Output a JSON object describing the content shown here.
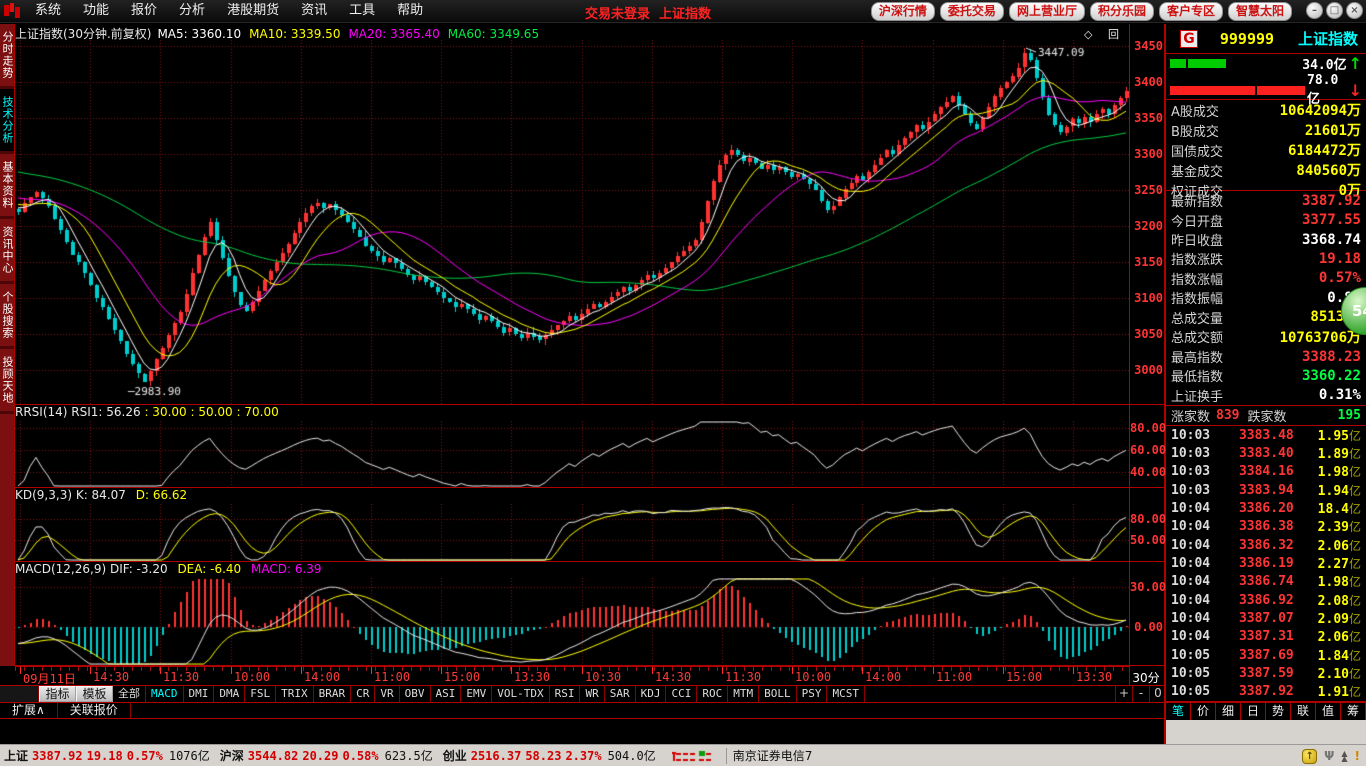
{
  "top": {
    "menu": [
      "系统",
      "功能",
      "报价",
      "分析",
      "港股期货",
      "资讯",
      "工具",
      "帮助"
    ],
    "login_status": "交易未登录",
    "current_quote": "上证指数",
    "buttons": [
      "沪深行情",
      "委托交易",
      "网上营业厅",
      "积分乐园",
      "客户专区",
      "智慧太阳"
    ],
    "window_controls": [
      "–",
      "□",
      "×"
    ]
  },
  "sidebar": {
    "items": [
      {
        "label": "分时走势",
        "active": false
      },
      {
        "label": "技术分析",
        "active": true
      },
      {
        "label": "基本资料",
        "active": false
      },
      {
        "label": "资讯中心",
        "active": false
      },
      {
        "label": "个股搜索",
        "active": false
      },
      {
        "label": "投顾天地",
        "active": false
      }
    ]
  },
  "chart": {
    "title": "上证指数(30分钟.前复权)",
    "ma_labels": [
      {
        "text": "MA5: 3360.10",
        "color": "#ffffff"
      },
      {
        "text": "MA10: 3339.50",
        "color": "#ffff00"
      },
      {
        "text": "MA20: 3365.40",
        "color": "#ff00ff"
      },
      {
        "text": "MA60: 3349.65",
        "color": "#00ee44"
      }
    ],
    "corner_icons": "◇ 回",
    "period": "30分钟"
  },
  "panels": {
    "rsi": {
      "white": "RRSI(14) RSI1: 56.26",
      "yellow": ": 30.00 : 50.00 : 70.00",
      "levels": [
        {
          "v": 80,
          "t": "80.00"
        },
        {
          "v": 60,
          "t": "60.00"
        },
        {
          "v": 40,
          "t": "40.00"
        }
      ]
    },
    "kd": {
      "white": "KD(9,3,3) K: 84.07",
      "yellow": "D: 66.62",
      "levels": [
        {
          "v": 80,
          "t": "80.00"
        },
        {
          "v": 50,
          "t": "50.00"
        }
      ]
    },
    "macd": {
      "white": "MACD(12,26,9) DIF: -3.20",
      "yellow": "DEA: -6.40",
      "magenta": "MACD: 6.39",
      "levels": [
        {
          "v": 30,
          "t": "30.00"
        },
        {
          "v": 0,
          "t": "0.00"
        }
      ]
    }
  },
  "indicator_bar": {
    "buttons": [
      "指标",
      "模板"
    ],
    "tabs": [
      "全部",
      "MACD",
      "DMI",
      "DMA",
      "FSL",
      "TRIX",
      "BRAR",
      "CR",
      "VR",
      "OBV",
      "ASI",
      "EMV",
      "VOL-TDX",
      "RSI",
      "WR",
      "SAR",
      "KDJ",
      "CCI",
      "ROC",
      "MTM",
      "BOLL",
      "PSY",
      "MCST"
    ],
    "active_tab": "MACD",
    "zoom": [
      "+",
      "-",
      "0"
    ]
  },
  "bottom_tabs": [
    "扩展∧",
    "关联报价"
  ],
  "status_bar": {
    "indices": [
      {
        "name": "上证",
        "value": "3387.92",
        "chg": "19.18",
        "pct": "0.57%",
        "amt": "1076亿"
      },
      {
        "name": "沪深",
        "value": "3544.82",
        "chg": "20.29",
        "pct": "0.58%",
        "amt": "623.5亿"
      },
      {
        "name": "创业",
        "value": "2516.37",
        "chg": "58.23",
        "pct": "2.37%",
        "amt": "504.0亿"
      }
    ],
    "broker": "南京证券电信7",
    "icons": [
      "coin-up-icon",
      "antenna-icon",
      "arrows-icon",
      "alert-icon"
    ]
  },
  "quote": {
    "logo": "G",
    "code": "999999",
    "name": "上证指数",
    "flow": {
      "up": "34.0亿",
      "up_arrow": "↑",
      "down": "78.0亿",
      "down_arrow": "↓",
      "up_segments": [
        16,
        38
      ],
      "down_segments": [
        85,
        48
      ]
    },
    "stats1": [
      {
        "label": "A股成交",
        "value": "10642094万"
      },
      {
        "label": "B股成交",
        "value": "21601万"
      },
      {
        "label": "国债成交",
        "value": "6184472万"
      },
      {
        "label": "基金成交",
        "value": "840560万"
      },
      {
        "label": "权证成交",
        "value": "0万"
      }
    ],
    "stats2": [
      {
        "label": "最新指数",
        "value": "3387.92",
        "color": "red"
      },
      {
        "label": "今日开盘",
        "value": "3377.55",
        "color": "red"
      },
      {
        "label": "昨日收盘",
        "value": "3368.74",
        "color": "white"
      },
      {
        "label": "指数涨跌",
        "value": "19.18",
        "color": "red"
      },
      {
        "label": "指数涨幅",
        "value": "0.57%",
        "color": "red"
      },
      {
        "label": "指数振幅",
        "value": "0.83",
        "color": "white"
      },
      {
        "label": "总成交量",
        "value": "851330",
        "color": "yellow"
      },
      {
        "label": "总成交额",
        "value": "10763706万",
        "color": "yellow"
      },
      {
        "label": "最高指数",
        "value": "3388.23",
        "color": "red"
      },
      {
        "label": "最低指数",
        "value": "3360.22",
        "color": "green"
      },
      {
        "label": "上证换手",
        "value": "0.31%",
        "color": "white"
      }
    ],
    "breadth": {
      "up_label": "涨家数",
      "up": "839",
      "down_label": "跌家数",
      "down": "195"
    },
    "ticks": [
      [
        "10:03",
        "3383.48",
        "1.95"
      ],
      [
        "10:03",
        "3383.40",
        "1.89"
      ],
      [
        "10:03",
        "3384.16",
        "1.98"
      ],
      [
        "10:03",
        "3383.94",
        "1.94"
      ],
      [
        "10:04",
        "3386.20",
        "18.4"
      ],
      [
        "10:04",
        "3386.38",
        "2.39"
      ],
      [
        "10:04",
        "3386.32",
        "2.06"
      ],
      [
        "10:04",
        "3386.19",
        "2.27"
      ],
      [
        "10:04",
        "3386.74",
        "1.98"
      ],
      [
        "10:04",
        "3386.92",
        "2.08"
      ],
      [
        "10:04",
        "3387.07",
        "2.09"
      ],
      [
        "10:04",
        "3387.31",
        "2.06"
      ],
      [
        "10:05",
        "3387.69",
        "1.84"
      ],
      [
        "10:05",
        "3387.59",
        "2.10"
      ],
      [
        "10:05",
        "3387.92",
        "1.91"
      ]
    ],
    "tick_suffix": "亿",
    "tabs": [
      "笔",
      "价",
      "细",
      "日",
      "势",
      "联",
      "值",
      "筹"
    ],
    "active_tab": "笔",
    "bubble": "54"
  },
  "chart_data": {
    "type": "candlestick",
    "symbol": "上证指数",
    "period": "30分钟",
    "ylim": [
      2953,
      3458
    ],
    "y_ticks": [
      3450,
      3400,
      3350,
      3300,
      3250,
      3200,
      3150,
      3100,
      3050,
      3000
    ],
    "x_labels": [
      "09月11日",
      "14:30",
      "11:30",
      "10:00",
      "14:00",
      "11:00",
      "15:00",
      "13:30",
      "10:30",
      "14:30",
      "11:30",
      "10:00",
      "14:00",
      "11:00",
      "15:00",
      "13:30"
    ],
    "high_annotation": 3447.09,
    "high_bar": 168,
    "low_annotation": 2983.9,
    "low_bar": 21,
    "closes": [
      3220,
      3232,
      3240,
      3247,
      3238,
      3228,
      3210,
      3195,
      3178,
      3160,
      3150,
      3135,
      3118,
      3100,
      3088,
      3072,
      3055,
      3040,
      3022,
      3008,
      2995,
      2984,
      2998,
      3015,
      3030,
      3048,
      3065,
      3080,
      3105,
      3135,
      3160,
      3185,
      3205,
      3180,
      3155,
      3130,
      3108,
      3090,
      3082,
      3095,
      3110,
      3125,
      3138,
      3150,
      3162,
      3175,
      3190,
      3205,
      3218,
      3228,
      3232,
      3225,
      3230,
      3222,
      3215,
      3205,
      3195,
      3185,
      3172,
      3165,
      3158,
      3150,
      3155,
      3148,
      3140,
      3132,
      3125,
      3130,
      3122,
      3115,
      3108,
      3100,
      3095,
      3088,
      3092,
      3085,
      3078,
      3070,
      3075,
      3068,
      3060,
      3052,
      3058,
      3050,
      3045,
      3052,
      3047,
      3042,
      3048,
      3055,
      3062,
      3068,
      3075,
      3070,
      3078,
      3085,
      3092,
      3088,
      3095,
      3102,
      3108,
      3115,
      3110,
      3118,
      3125,
      3132,
      3128,
      3135,
      3142,
      3150,
      3158,
      3165,
      3172,
      3180,
      3205,
      3235,
      3262,
      3285,
      3298,
      3305,
      3298,
      3290,
      3295,
      3288,
      3280,
      3285,
      3278,
      3282,
      3275,
      3268,
      3272,
      3265,
      3258,
      3250,
      3235,
      3222,
      3228,
      3240,
      3252,
      3260,
      3270,
      3265,
      3275,
      3285,
      3295,
      3305,
      3300,
      3312,
      3322,
      3330,
      3340,
      3335,
      3345,
      3355,
      3365,
      3372,
      3380,
      3368,
      3355,
      3342,
      3335,
      3350,
      3365,
      3380,
      3392,
      3400,
      3408,
      3420,
      3440,
      3430,
      3405,
      3378,
      3355,
      3340,
      3330,
      3338,
      3348,
      3342,
      3352,
      3345,
      3356,
      3362,
      3355,
      3368,
      3378,
      3387.92
    ],
    "indicators": {
      "ma": {
        "MA5": 3360.1,
        "MA10": 3339.5,
        "MA20": 3365.4,
        "MA60": 3349.65
      },
      "rsi": {
        "RSI1": 56.26,
        "levels": [
          30,
          50,
          70
        ]
      },
      "kd": {
        "K": 84.07,
        "D": 66.62
      },
      "macd": {
        "DIF": -3.2,
        "DEA": -6.4,
        "MACD": 6.39
      }
    }
  },
  "colors": {
    "up": "#ff3232",
    "down": "#00cdcd",
    "ma5": "#ffffff",
    "ma10": "#ffff00",
    "ma20": "#ff00ff",
    "ma60": "#00cc44",
    "axis_text": "#ff3434",
    "grid": "#801212",
    "panel_border": "#b00000",
    "value_yellow": "#ffff00",
    "value_red": "#ff3535",
    "value_green": "#00ff44",
    "statusbar_bg": "#d6d3ce"
  }
}
